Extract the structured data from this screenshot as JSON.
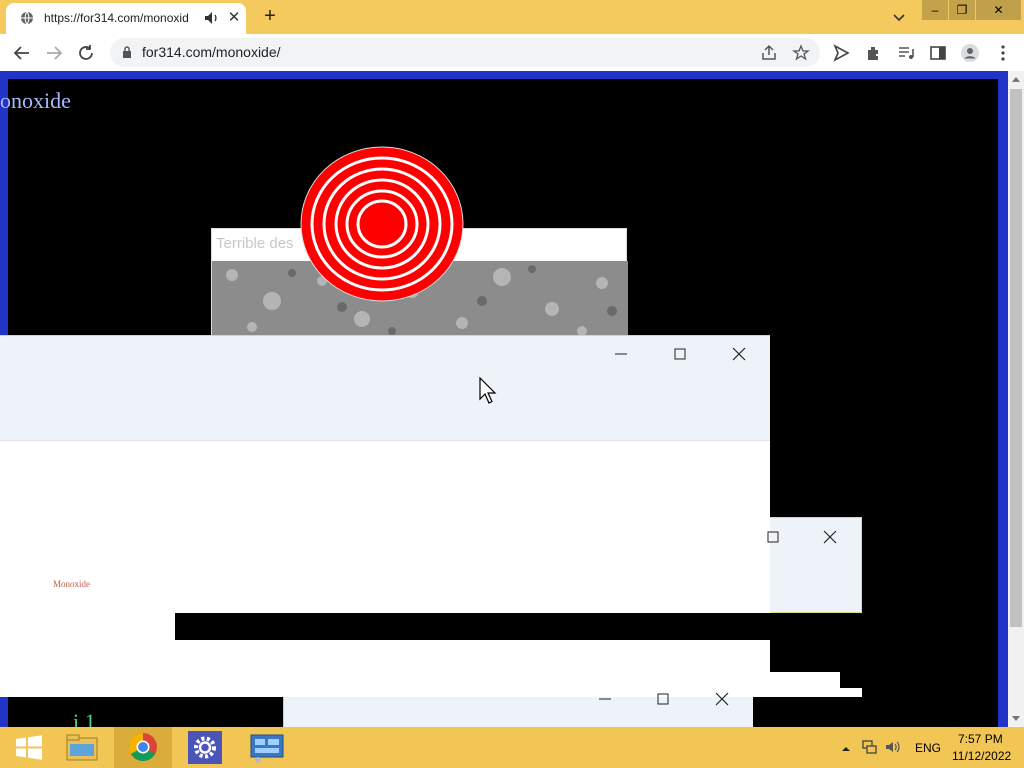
{
  "browser": {
    "tab_title": "https://for314.com/monoxid",
    "url": "for314.com/monoxide/",
    "window_controls": {
      "minimize": "–",
      "restore": "❐",
      "close": "✕"
    }
  },
  "page": {
    "title": "onoxide",
    "stone_caption": "Terrible des",
    "window_label": "Monoxide",
    "window_bottom_text": "i 1"
  },
  "taskbar": {
    "lang": "ENG",
    "time": "7:57 PM",
    "date": "11/12/2022",
    "apps": [
      "start-icon",
      "file-explorer-icon",
      "chrome-icon",
      "settings-icon",
      "control-panel-icon"
    ]
  },
  "colors": {
    "taskbar": "#f2c655",
    "titlebar": "#f4c95d",
    "page_border": "#2233c8",
    "target_red": "#ff0000",
    "title_text": "#a9b8ff"
  }
}
